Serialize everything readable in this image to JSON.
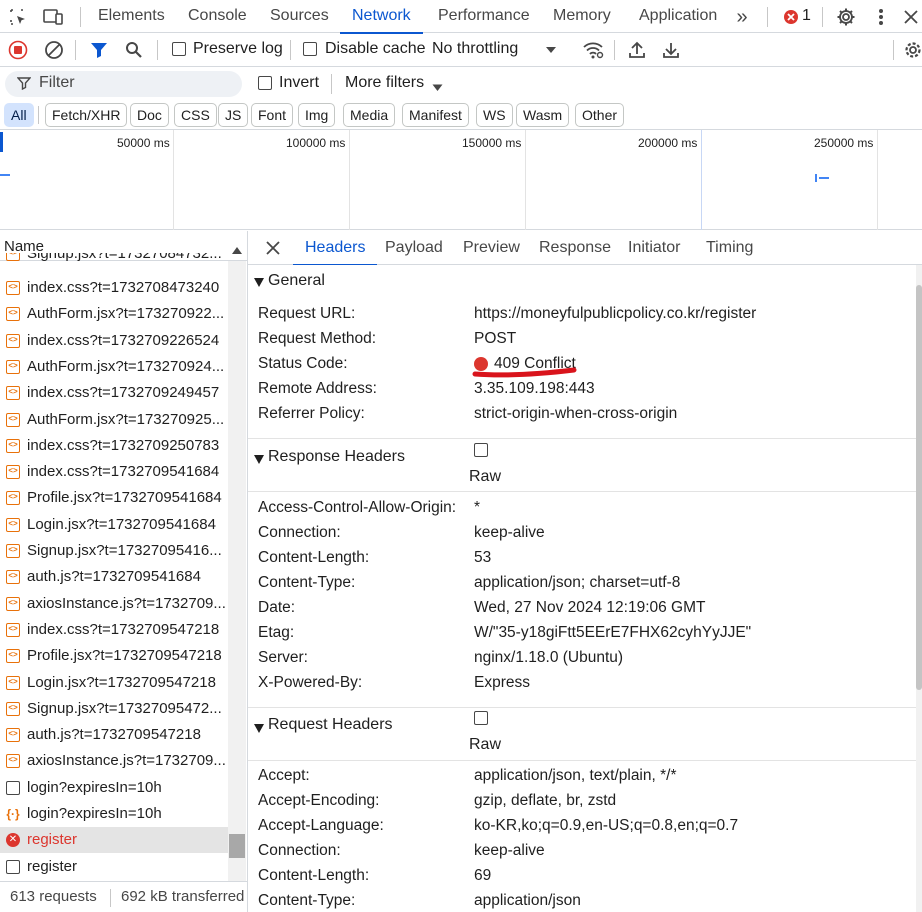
{
  "topbar": {
    "tabs": [
      "Elements",
      "Console",
      "Sources",
      "Network",
      "Performance",
      "Memory",
      "Application"
    ],
    "active_tab": "Network",
    "more_tabs": "»",
    "error_count": "1"
  },
  "toolbar": {
    "preserve_log": "Preserve log",
    "disable_cache": "Disable cache",
    "throttling": "No throttling"
  },
  "filter": {
    "placeholder": "Filter",
    "invert": "Invert",
    "more_filters": "More filters"
  },
  "type_filters": [
    "All",
    "Fetch/XHR",
    "Doc",
    "CSS",
    "JS",
    "Font",
    "Img",
    "Media",
    "Manifest",
    "WS",
    "Wasm",
    "Other"
  ],
  "timeline": {
    "labels": [
      "50000 ms",
      "100000 ms",
      "150000 ms",
      "200000 ms",
      "250000 ms"
    ]
  },
  "request_list": {
    "header": "Name",
    "partial_top": "Signup.jsx?t=17327084732...",
    "rows": [
      {
        "name": "index.css?t=1732708473240",
        "type": "css"
      },
      {
        "name": "AuthForm.jsx?t=173270922...",
        "type": "js"
      },
      {
        "name": "index.css?t=1732709226524",
        "type": "css"
      },
      {
        "name": "AuthForm.jsx?t=173270924...",
        "type": "js"
      },
      {
        "name": "index.css?t=1732709249457",
        "type": "css"
      },
      {
        "name": "AuthForm.jsx?t=173270925...",
        "type": "js"
      },
      {
        "name": "index.css?t=1732709250783",
        "type": "css"
      },
      {
        "name": "index.css?t=1732709541684",
        "type": "css"
      },
      {
        "name": "Profile.jsx?t=1732709541684",
        "type": "js"
      },
      {
        "name": "Login.jsx?t=1732709541684",
        "type": "js"
      },
      {
        "name": "Signup.jsx?t=17327095416...",
        "type": "js"
      },
      {
        "name": "auth.js?t=1732709541684",
        "type": "js"
      },
      {
        "name": "axiosInstance.js?t=1732709...",
        "type": "js"
      },
      {
        "name": "index.css?t=1732709547218",
        "type": "css"
      },
      {
        "name": "Profile.jsx?t=1732709547218",
        "type": "js"
      },
      {
        "name": "Login.jsx?t=1732709547218",
        "type": "js"
      },
      {
        "name": "Signup.jsx?t=17327095472...",
        "type": "js"
      },
      {
        "name": "auth.js?t=1732709547218",
        "type": "js"
      },
      {
        "name": "axiosInstance.js?t=1732709...",
        "type": "js"
      },
      {
        "name": "login?expiresIn=10h",
        "type": "doc"
      },
      {
        "name": "login?expiresIn=10h",
        "type": "xhr"
      },
      {
        "name": "register",
        "type": "error"
      },
      {
        "name": "register",
        "type": "doc"
      }
    ],
    "footer_requests": "613 requests",
    "footer_transferred": "692 kB transferred"
  },
  "details": {
    "tabs": [
      "Headers",
      "Payload",
      "Preview",
      "Response",
      "Initiator",
      "Timing"
    ],
    "active_tab": "Headers",
    "general": {
      "title": "General",
      "rows": [
        {
          "k": "Request URL:",
          "v": "https://moneyfulpublicpolicy.co.kr/register"
        },
        {
          "k": "Request Method:",
          "v": "POST"
        },
        {
          "k": "Status Code:",
          "v": "409 Conflict"
        },
        {
          "k": "Remote Address:",
          "v": "3.35.109.198:443"
        },
        {
          "k": "Referrer Policy:",
          "v": "strict-origin-when-cross-origin"
        }
      ]
    },
    "response_headers": {
      "title": "Response Headers",
      "raw": "Raw",
      "rows": [
        {
          "k": "Access-Control-Allow-Origin:",
          "v": "*"
        },
        {
          "k": "Connection:",
          "v": "keep-alive"
        },
        {
          "k": "Content-Length:",
          "v": "53"
        },
        {
          "k": "Content-Type:",
          "v": "application/json; charset=utf-8"
        },
        {
          "k": "Date:",
          "v": "Wed, 27 Nov 2024 12:19:06 GMT"
        },
        {
          "k": "Etag:",
          "v": "W/\"35-y18giFtt5EErE7FHX62cyhYyJJE\""
        },
        {
          "k": "Server:",
          "v": "nginx/1.18.0 (Ubuntu)"
        },
        {
          "k": "X-Powered-By:",
          "v": "Express"
        }
      ]
    },
    "request_headers": {
      "title": "Request Headers",
      "raw": "Raw",
      "rows": [
        {
          "k": "Accept:",
          "v": "application/json, text/plain, */*"
        },
        {
          "k": "Accept-Encoding:",
          "v": "gzip, deflate, br, zstd"
        },
        {
          "k": "Accept-Language:",
          "v": "ko-KR,ko;q=0.9,en-US;q=0.8,en;q=0.7"
        },
        {
          "k": "Connection:",
          "v": "keep-alive"
        },
        {
          "k": "Content-Length:",
          "v": "69"
        },
        {
          "k": "Content-Type:",
          "v": "application/json"
        }
      ]
    }
  },
  "colors": {
    "accent": "#0b57d0",
    "error": "#dc362e",
    "annotation": "#d9141c"
  }
}
